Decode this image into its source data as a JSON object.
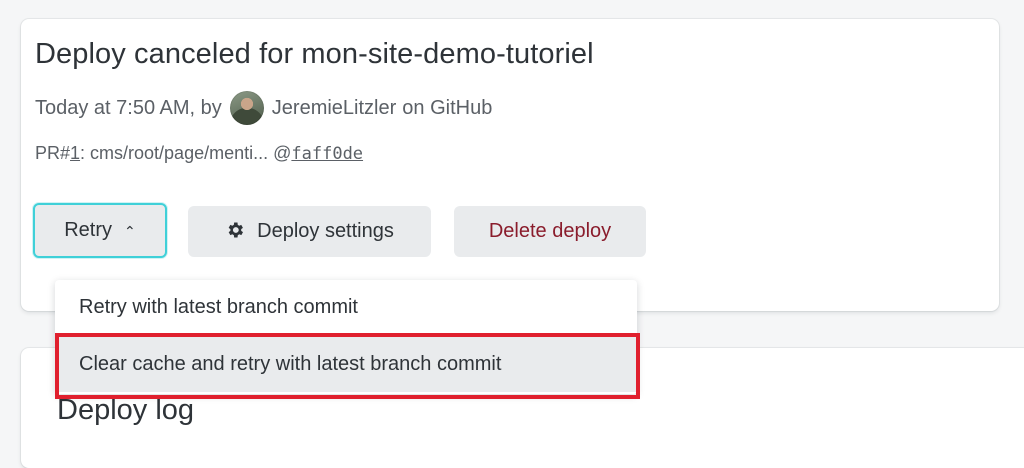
{
  "deploy": {
    "title": "Deploy canceled for mon-site-demo-tutoriel",
    "meta_prefix": "Today at 7:50 AM, by",
    "author": "JeremieLitzler",
    "meta_suffix": "on GitHub",
    "pr_prefix": "PR#",
    "pr_number": "1",
    "pr_path": ": cms/root/page/menti... @",
    "commit_sha": "faff0de"
  },
  "actions": {
    "retry_label": "Retry",
    "retry_chevron": "⌃",
    "settings_icon": "gear-icon",
    "settings_label": "Deploy settings",
    "delete_label": "Delete deploy"
  },
  "dropdown": {
    "items": [
      {
        "label": "Retry with latest branch commit"
      },
      {
        "label": "Clear cache and retry with latest branch commit",
        "highlighted": true
      }
    ]
  },
  "log": {
    "title": "Deploy log"
  },
  "colors": {
    "focus_ring": "#3fd0d8",
    "delete_text": "#8a1c2c",
    "highlight_border": "#e0202e"
  }
}
